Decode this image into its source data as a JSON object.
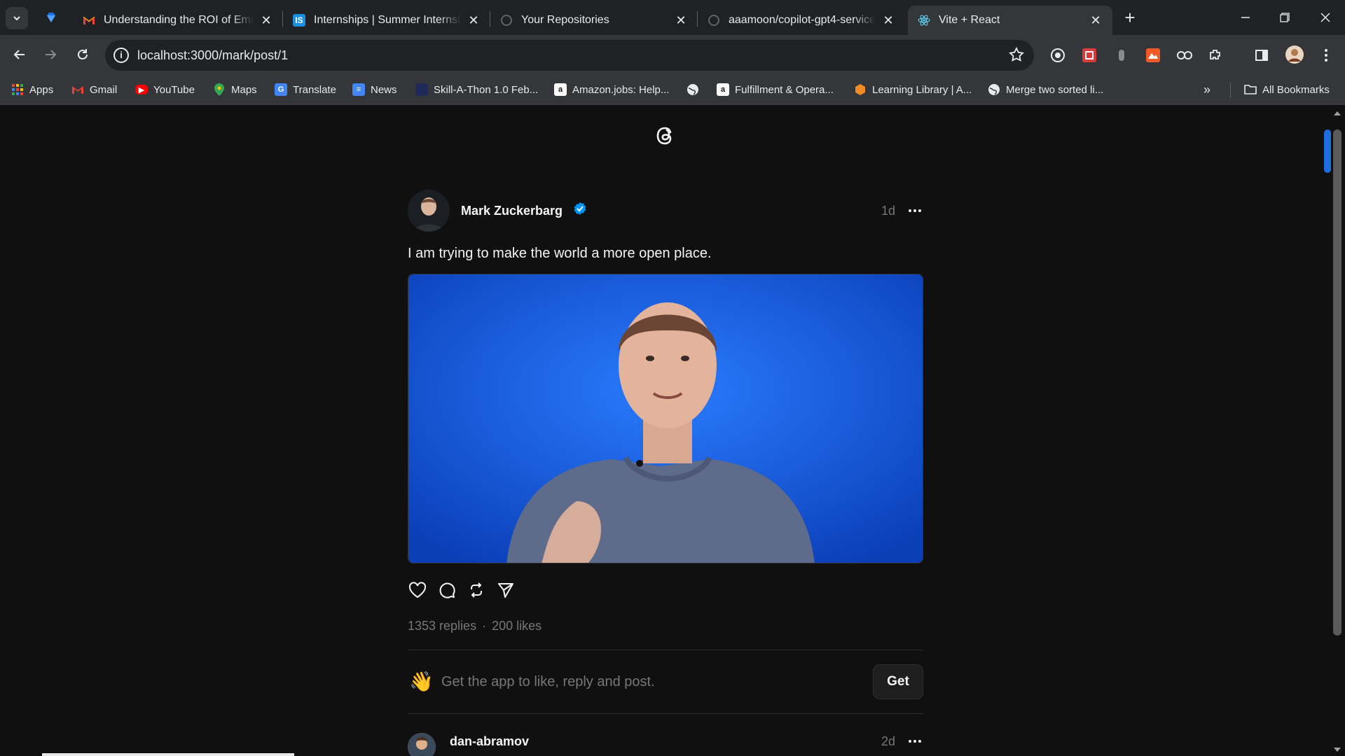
{
  "browser": {
    "tabs": [
      {
        "title": "Understanding the ROI of Empl",
        "icon": "gmail-icon"
      },
      {
        "title": "Internships | Summer Internship",
        "icon": "internshala-icon"
      },
      {
        "title": "Your Repositories",
        "icon": "loading-icon"
      },
      {
        "title": "aaamoon/copilot-gpt4-service:",
        "icon": "loading-icon"
      },
      {
        "title": "Vite + React",
        "icon": "react-icon",
        "active": true
      }
    ],
    "url": "localhost:3000/mark/post/1",
    "bookmarks": [
      {
        "label": "Apps"
      },
      {
        "label": "Gmail"
      },
      {
        "label": "YouTube"
      },
      {
        "label": "Maps"
      },
      {
        "label": "Translate"
      },
      {
        "label": "News"
      },
      {
        "label": "Skill-A-Thon 1.0 Feb..."
      },
      {
        "label": "Amazon.jobs: Help..."
      },
      {
        "label": "Fulfillment & Opera..."
      },
      {
        "label": "Learning Library | A..."
      },
      {
        "label": "Merge two sorted li..."
      }
    ],
    "all_bookmarks": "All Bookmarks"
  },
  "post": {
    "author": "Mark Zuckerbarg",
    "time": "1d",
    "text": "I am trying to make the world a more open place.",
    "replies": "1353 replies",
    "separator": "·",
    "likes": "200 likes"
  },
  "getapp": {
    "text": "Get the app to like, reply and post.",
    "button": "Get"
  },
  "reply": {
    "author": "dan-abramov",
    "time": "2d"
  },
  "colors": {
    "background": "#101010",
    "chrome": "#35363a",
    "tabstrip": "#202124",
    "verified": "#0095f6",
    "photo_bg": "#0b55d8"
  }
}
